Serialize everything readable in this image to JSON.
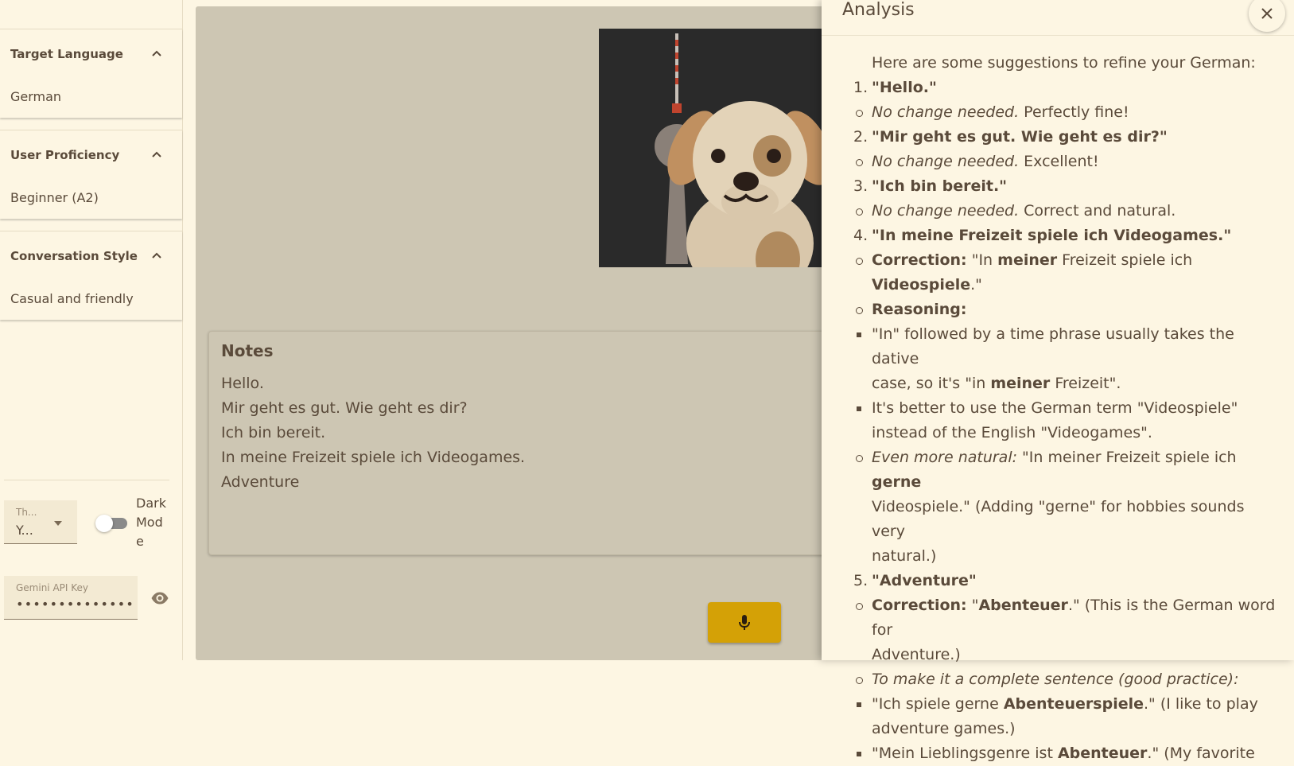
{
  "sidebar": {
    "panels": [
      {
        "title": "Target Language",
        "value": "German"
      },
      {
        "title": "User Proficiency",
        "value": "Beginner (A2)"
      },
      {
        "title": "Conversation Style",
        "value": "Casual and friendly"
      }
    ],
    "theme": {
      "label": "Th...",
      "value": "Y..."
    },
    "dark_mode": {
      "label": "Dark Mode",
      "on": false
    },
    "api_key": {
      "label": "Gemini API Key",
      "value": "•••••••••••••••"
    }
  },
  "main": {
    "notes": {
      "title": "Notes",
      "lines": [
        "Hello.",
        "Mir geht es gut. Wie geht es dir?",
        "Ich bin bereit.",
        "In meine Freizeit spiele ich Videogames.",
        "Adventure"
      ]
    }
  },
  "analysis": {
    "title": "Analysis",
    "intro": "Here are some suggestions to refine your German:",
    "items": [
      {
        "num": "1.",
        "phrase": "\"Hello.\"",
        "note_em": "No change needed.",
        "note": " Perfectly fine!"
      },
      {
        "num": "2.",
        "phrase": "\"Mir geht es gut. Wie geht es dir?\"",
        "note_em": "No change needed.",
        "note": " Excellent!"
      },
      {
        "num": "3.",
        "phrase": "\"Ich bin bereit.\"",
        "note_em": "No change needed.",
        "note": " Correct and natural."
      }
    ],
    "item4": {
      "num": "4.",
      "phrase": "\"In meine Freizeit spiele ich Videogames.\"",
      "correction_label": "Correction:",
      "correction_a": " \"In ",
      "correction_b": "meiner",
      "correction_c": " Freizeit spiele ich",
      "correction_d": "Videospiele",
      "correction_e": ".\"",
      "reasoning_label": "Reasoning:",
      "reason1_a": "\"In\" followed by a time phrase usually takes the dative",
      "reason1_b": "case, so it's \"in ",
      "reason1_c": "meiner",
      "reason1_d": " Freizeit\".",
      "reason2_a": "It's better to use the German term \"Videospiele\"",
      "reason2_b": "instead of the English \"Videogames\".",
      "natural_label": "Even more natural:",
      "natural_a": " \"In meiner Freizeit spiele ich ",
      "natural_b": "gerne",
      "natural_c": "Videospiele.\" (Adding \"gerne\" for hobbies sounds very",
      "natural_d": "natural.)"
    },
    "item5": {
      "num": "5.",
      "phrase": "\"Adventure\"",
      "correction_label": "Correction:",
      "correction_a": " \"",
      "correction_b": "Abenteuer",
      "correction_c": ".\" (This is the German word for",
      "correction_d": "Adventure.)",
      "practice": "To make it a complete sentence (good practice):",
      "ex1_a": "\"Ich spiele gerne ",
      "ex1_b": "Abenteuerspiele",
      "ex1_c": ".\" (I like to play",
      "ex1_d": "adventure games.)",
      "ex2_a": "\"Mein Lieblingsgenre ist ",
      "ex2_b": "Abenteuer",
      "ex2_c": ".\" (My favorite"
    }
  },
  "colors": {
    "background": "#fdf6e3",
    "main_surface": "#cdc6b3",
    "accent": "#d4a106",
    "text": "#5a4a3a"
  },
  "icons": [
    "chevron-up-icon",
    "dropdown-caret-icon",
    "eye-icon",
    "microphone-icon",
    "close-icon"
  ]
}
